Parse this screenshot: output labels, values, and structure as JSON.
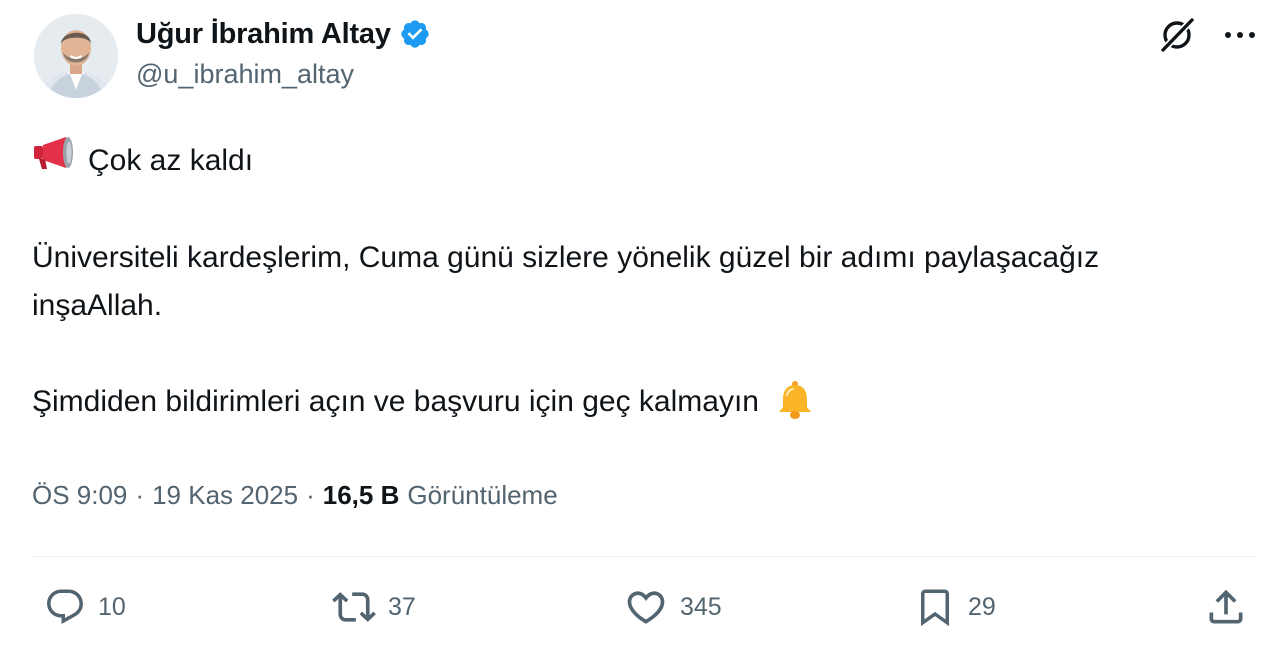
{
  "author": {
    "display_name": "Uğur İbrahim Altay",
    "handle": "@u_ibrahim_altay",
    "verified": true
  },
  "colors": {
    "verified_badge": "#1d9bf0",
    "text_primary": "#0f1419",
    "text_secondary": "#536471"
  },
  "tweet": {
    "line1": "Çok az kaldı",
    "line1_emoji": "megaphone-icon",
    "paragraph2": "Üniversiteli kardeşlerim, Cuma günü sizlere yönelik güzel bir adımı paylaşacağız inşaAllah.",
    "paragraph3": "Şimdiden bildirimleri açın ve başvuru için geç kalmayın",
    "paragraph3_emoji": "bell-icon"
  },
  "meta": {
    "time": "ÖS 9:09",
    "separator": "·",
    "date": "19 Kas 2025",
    "views_count": "16,5 B",
    "views_label": "Görüntüleme"
  },
  "actions": {
    "replies": "10",
    "reposts": "37",
    "likes": "345",
    "bookmarks": "29"
  }
}
